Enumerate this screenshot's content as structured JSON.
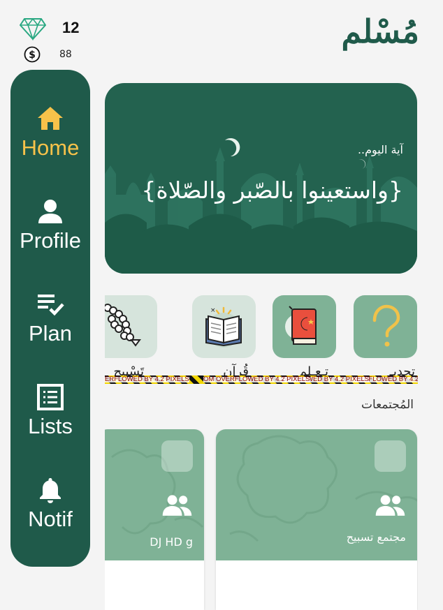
{
  "stats": {
    "gems": "12",
    "coins": "88"
  },
  "logo": "مُسْلم",
  "sidebar": {
    "items": [
      {
        "label": "Home",
        "icon": "home-icon",
        "active": true
      },
      {
        "label": "Profile",
        "icon": "person-icon",
        "active": false
      },
      {
        "label": "Plan",
        "icon": "checklist-icon",
        "active": false
      },
      {
        "label": "Lists",
        "icon": "list-icon",
        "active": false
      },
      {
        "label": "Notif",
        "icon": "bell-icon",
        "active": false
      }
    ]
  },
  "banner": {
    "subtitle": "آية اليوم..",
    "verse": "{واستعينوا بالصّبر والصّلاة}"
  },
  "tiles": [
    {
      "icon": "question-icon",
      "label": "تحديـ"
    },
    {
      "icon": "islamic-book-icon",
      "label": "تـعـلم"
    },
    {
      "icon": "quran-book-icon",
      "label": "قُرآن"
    },
    {
      "icon": "prayer-beads-icon",
      "label": "تَسْبيح"
    }
  ],
  "overflow_warnings": [
    "VERFLOWED BY 4.2 PIXELS",
    "VERFLOWED BY 4.2 PIXELS",
    "VERFLOWED BY 4.2 PIXELS",
    "OM OVERFLOWED BY 4.2 PIXELS",
    "ERFLOWED BY 4.2 PIXELS"
  ],
  "communities_title": "المُجتمعات",
  "communities": [
    {
      "name": "مجتمع تسبيح"
    },
    {
      "name": "DJ HD g"
    }
  ],
  "colors": {
    "primary": "#1f5a4a",
    "accent": "#f7c24a",
    "tile_mid": "#7fb296",
    "tile_light": "#d6e4dc",
    "background": "#f4f4f4"
  }
}
